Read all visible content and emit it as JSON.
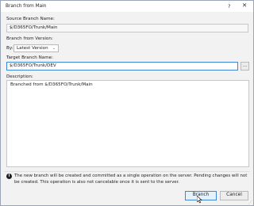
{
  "window": {
    "title": "Branch from Main"
  },
  "source": {
    "label": "Source Branch Name:",
    "value": "$/D365FO/Trunk/Main"
  },
  "branch_from": {
    "label": "Branch from Version:",
    "by_label": "By:",
    "by_value": "Latest Version"
  },
  "target": {
    "label": "Target Branch Name:",
    "value": "$/D365FO/Trunk/DEV",
    "browse_label": "..."
  },
  "description": {
    "label": "Description:",
    "value": "Branched from $/D365FO/Trunk/Main"
  },
  "info": {
    "text": "The new branch will be created and committed as a single operation on the server. Pending changes will not be created. This operation is also not cancelable once it is sent to the server."
  },
  "buttons": {
    "branch": "Branch",
    "cancel": "Cancel"
  }
}
